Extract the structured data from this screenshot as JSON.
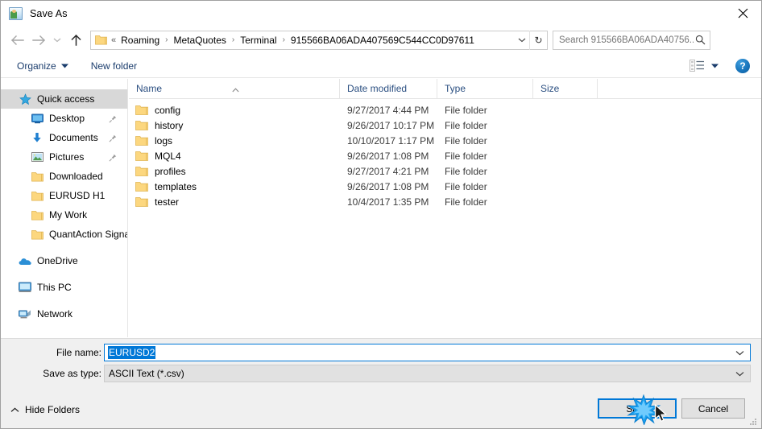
{
  "window": {
    "title": "Save As",
    "title_icon": "save-as-icon",
    "close_icon": "close-icon"
  },
  "nav": {
    "back_icon": "back-arrow-icon",
    "forward_icon": "forward-arrow-icon",
    "recent_icon": "chevron-down-icon",
    "up_icon": "up-arrow-icon"
  },
  "address": {
    "folder_icon": "folder-icon",
    "leading_sep": "«",
    "crumbs": [
      "Roaming",
      "MetaQuotes",
      "Terminal",
      "915566BA06ADA407569C544CC0D97611"
    ],
    "separator": "›",
    "dropdown_icon": "chevron-down-icon",
    "refresh_icon": "refresh-icon",
    "refresh_glyph": "↻"
  },
  "search": {
    "placeholder": "Search 915566BA06ADA40756...",
    "value": "",
    "icon": "search-icon"
  },
  "toolbar": {
    "organize_label": "Organize",
    "organize_caret_icon": "caret-down-icon",
    "new_folder_label": "New folder",
    "view_icon": "view-layout-icon",
    "view_caret_icon": "caret-down-icon",
    "help_label": "?",
    "help_icon": "help-icon"
  },
  "sidebar": {
    "items": [
      {
        "label": "Quick access",
        "icon": "star-icon",
        "level": 0,
        "selected": true,
        "pinned": false
      },
      {
        "label": "Desktop",
        "icon": "desktop-icon",
        "level": 1,
        "selected": false,
        "pinned": true
      },
      {
        "label": "Documents",
        "icon": "download-icon",
        "level": 1,
        "selected": false,
        "pinned": true
      },
      {
        "label": "Pictures",
        "icon": "pictures-icon",
        "level": 1,
        "selected": false,
        "pinned": true
      },
      {
        "label": "Downloaded",
        "icon": "folder-icon",
        "level": 1,
        "selected": false,
        "pinned": false
      },
      {
        "label": "EURUSD H1",
        "icon": "folder-icon",
        "level": 1,
        "selected": false,
        "pinned": false
      },
      {
        "label": "My Work",
        "icon": "folder-icon",
        "level": 1,
        "selected": false,
        "pinned": false
      },
      {
        "label": "QuantAction Signal",
        "icon": "folder-icon",
        "level": 1,
        "selected": false,
        "pinned": false
      },
      {
        "label": "OneDrive",
        "icon": "cloud-icon",
        "level": 0,
        "selected": false,
        "pinned": false,
        "gap_before": true
      },
      {
        "label": "This PC",
        "icon": "computer-icon",
        "level": 0,
        "selected": false,
        "pinned": false,
        "gap_before": true
      },
      {
        "label": "Network",
        "icon": "network-icon",
        "level": 0,
        "selected": false,
        "pinned": false,
        "gap_before": true
      }
    ]
  },
  "filelist": {
    "columns": [
      "Name",
      "Date modified",
      "Type",
      "Size"
    ],
    "sort_column": "Name",
    "sort_direction": "ascending",
    "sort_icon": "caret-up-icon",
    "rows": [
      {
        "name": "config",
        "date": "9/27/2017 4:44 PM",
        "type": "File folder",
        "size": "",
        "icon": "folder-icon"
      },
      {
        "name": "history",
        "date": "9/26/2017 10:17 PM",
        "type": "File folder",
        "size": "",
        "icon": "folder-icon"
      },
      {
        "name": "logs",
        "date": "10/10/2017 1:17 PM",
        "type": "File folder",
        "size": "",
        "icon": "folder-icon"
      },
      {
        "name": "MQL4",
        "date": "9/26/2017 1:08 PM",
        "type": "File folder",
        "size": "",
        "icon": "folder-icon"
      },
      {
        "name": "profiles",
        "date": "9/27/2017 4:21 PM",
        "type": "File folder",
        "size": "",
        "icon": "folder-icon"
      },
      {
        "name": "templates",
        "date": "9/26/2017 1:08 PM",
        "type": "File folder",
        "size": "",
        "icon": "folder-icon"
      },
      {
        "name": "tester",
        "date": "10/4/2017 1:35 PM",
        "type": "File folder",
        "size": "",
        "icon": "folder-icon"
      }
    ]
  },
  "form": {
    "filename_label": "File name:",
    "filename_value": "EURUSD2",
    "filename_selected": true,
    "filetype_label": "Save as type:",
    "filetype_value": "ASCII Text (*.csv)",
    "combo_arrow_icon": "chevron-down-icon"
  },
  "footer": {
    "hide_folders_label": "Hide Folders",
    "hide_folders_icon": "caret-up-icon",
    "save_label": "Save",
    "cancel_label": "Cancel",
    "resize_grip_icon": "resize-grip-icon",
    "cursor_icon": "mouse-pointer-icon",
    "click_flash_icon": "click-burst-icon"
  },
  "colors": {
    "accent": "#0078d7",
    "folder_yellow": "#fcd77f",
    "header_text": "#2b4f81",
    "panel_bg": "#f0f0f0",
    "selection_bg": "#d8d8d8"
  }
}
